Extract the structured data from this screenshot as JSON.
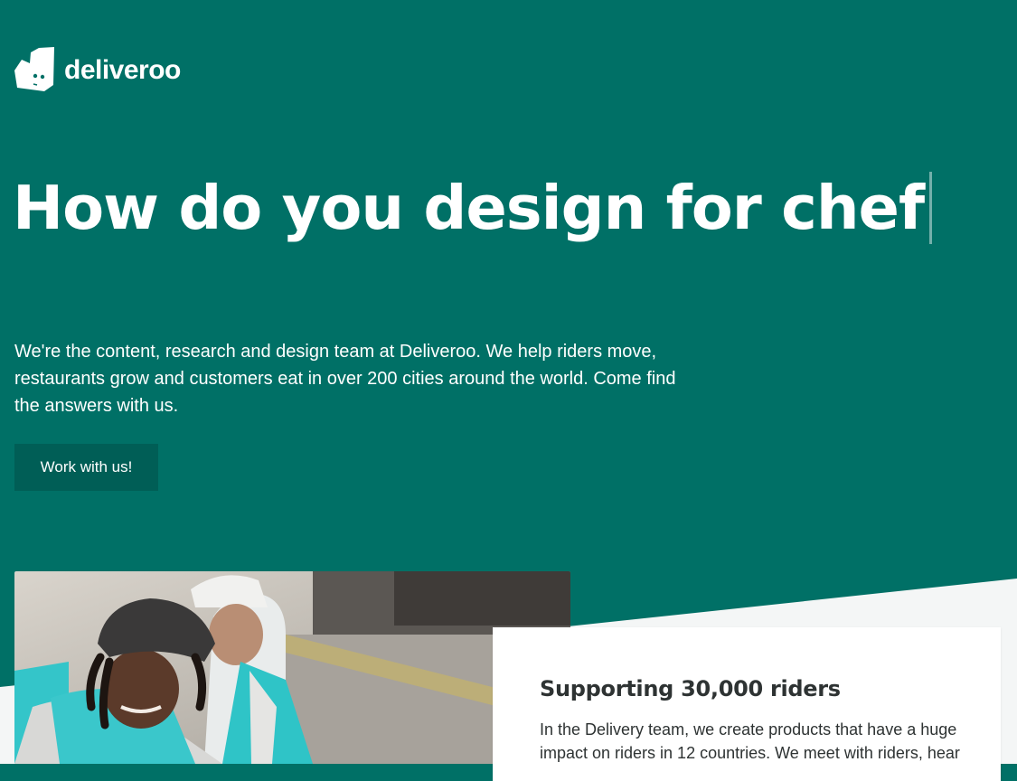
{
  "brand": {
    "name": "deliveroo",
    "logo_icon": "deliveroo-kangaroo-icon"
  },
  "hero": {
    "title": "How do you design for chef",
    "intro": "We're the content, research and design team at Deliveroo. We help riders move, restaurants grow and customers eat in over 200 cities around the world. Come find the answers with us.",
    "cta_label": "Work with us!"
  },
  "feature": {
    "image_subject": "riders-photo",
    "title": "Supporting 30,000 riders",
    "body": "In the Delivery team, we create products that have a huge impact on riders in 12 countries. We meet with riders, hear"
  },
  "colors": {
    "brand_teal": "#007066",
    "button_teal": "#005e56",
    "light_bg": "#f4f6f6",
    "text_dark": "#2e3333",
    "white": "#ffffff"
  }
}
